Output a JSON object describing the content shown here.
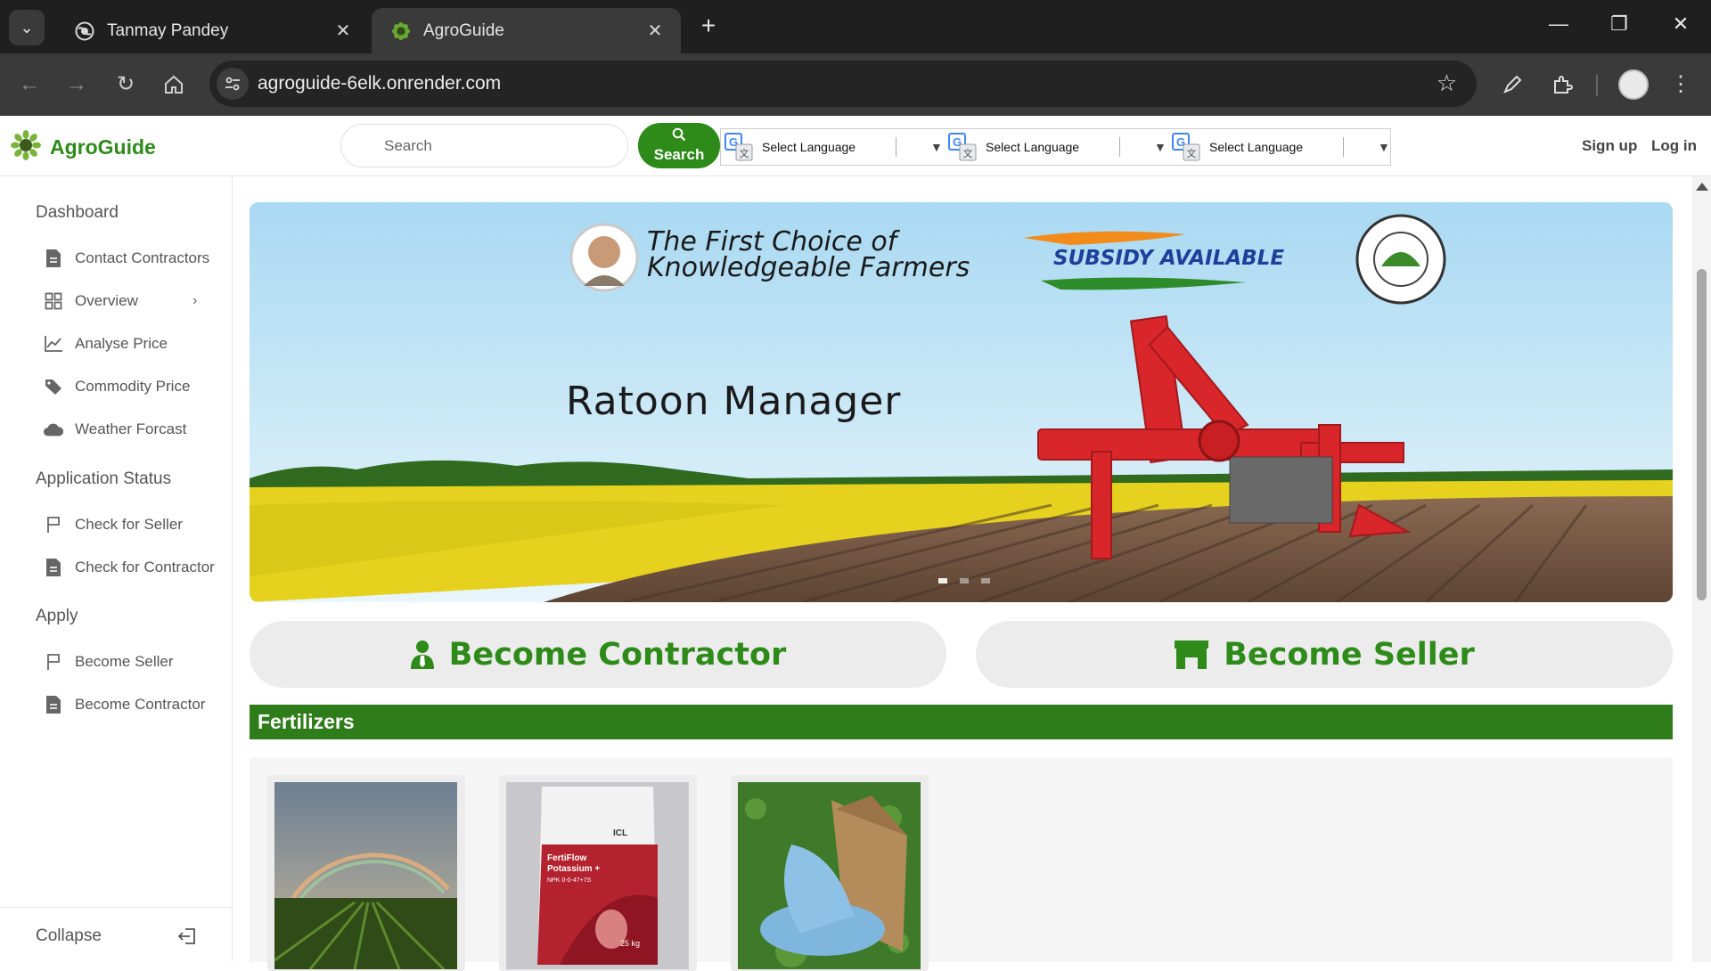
{
  "browser": {
    "tabs": [
      {
        "title": "Tanmay Pandey",
        "active": false
      },
      {
        "title": "AgroGuide",
        "active": true
      }
    ],
    "url": "agroguide-6elk.onrender.com"
  },
  "header": {
    "brand": "AgroGuide",
    "search_placeholder": "Search",
    "search_button": "Search",
    "language_selects": [
      "Select Language",
      "Select Language",
      "Select Language"
    ],
    "signup": "Sign up",
    "login": "Log in"
  },
  "sidebar": {
    "groups": [
      {
        "title": "Dashboard",
        "items": [
          {
            "label": "Contact Contractors",
            "icon": "document-icon"
          },
          {
            "label": "Overview",
            "icon": "grid-icon"
          },
          {
            "label": "Analyse Price",
            "icon": "line-chart-icon"
          },
          {
            "label": "Commodity Price",
            "icon": "tag-icon"
          },
          {
            "label": "Weather Forcast",
            "icon": "cloud-icon"
          }
        ]
      },
      {
        "title": "Application Status",
        "items": [
          {
            "label": "Check for Seller",
            "icon": "flag-icon"
          },
          {
            "label": "Check for Contractor",
            "icon": "document-icon"
          }
        ]
      },
      {
        "title": "Apply",
        "items": [
          {
            "label": "Become Seller",
            "icon": "flag-icon"
          },
          {
            "label": "Become Contractor",
            "icon": "document-icon"
          }
        ]
      }
    ],
    "collapse": "Collapse"
  },
  "banner": {
    "tagline_line1": "The First Choice of",
    "tagline_line2": "Knowledgeable Farmers",
    "subsidy": "SUBSIDY AVAILABLE",
    "product": "Ratoon Manager",
    "slide_count": 3,
    "active_slide": 1
  },
  "actions": {
    "contractor": "Become Contractor",
    "seller": "Become Seller"
  },
  "section": {
    "title": "Fertilizers",
    "products": [
      {
        "image": "rainbow-field-image"
      },
      {
        "image": "fertiflow-bag-image",
        "brand": "ICL",
        "name_line1": "FertiFlow",
        "name_line2": "Potassium +",
        "npk": "NPK 0-0-47+7S",
        "weight": "25 kg"
      },
      {
        "image": "fertilizer-sack-image"
      }
    ]
  },
  "colors": {
    "brand_green": "#2e8b1a",
    "section_green": "#2e7d1a",
    "chrome_dark": "#1f1f1f",
    "chrome_mid": "#3a3a3a"
  }
}
